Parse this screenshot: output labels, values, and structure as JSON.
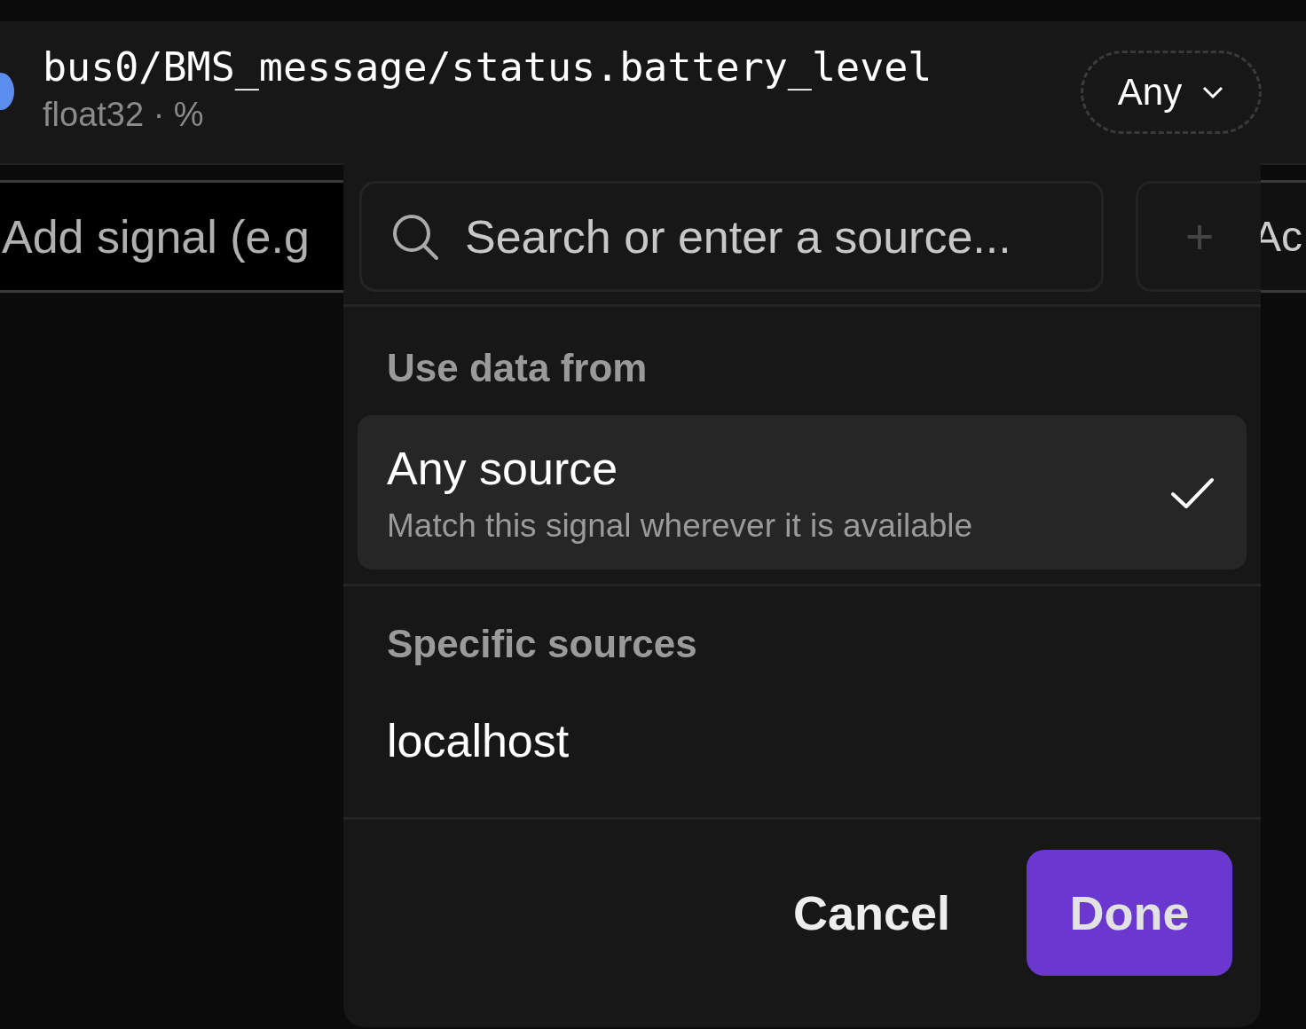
{
  "signal": {
    "path": "bus0/BMS_message/status.battery_level",
    "meta": "float32 · %",
    "source_button": "Any"
  },
  "add_row": {
    "placeholder": "Add signal (e.g",
    "action_button": "Ac"
  },
  "popover": {
    "search": {
      "placeholder": "Search or enter a source..."
    },
    "add_button": "+",
    "section_title": "Use data from",
    "options": [
      {
        "label": "Any source",
        "description": "Match this signal wherever it is available",
        "selected": true
      }
    ],
    "specific_title": "Specific sources",
    "sources": [
      {
        "label": "localhost",
        "selected": false
      }
    ],
    "cancel": "Cancel",
    "done": "Done"
  }
}
